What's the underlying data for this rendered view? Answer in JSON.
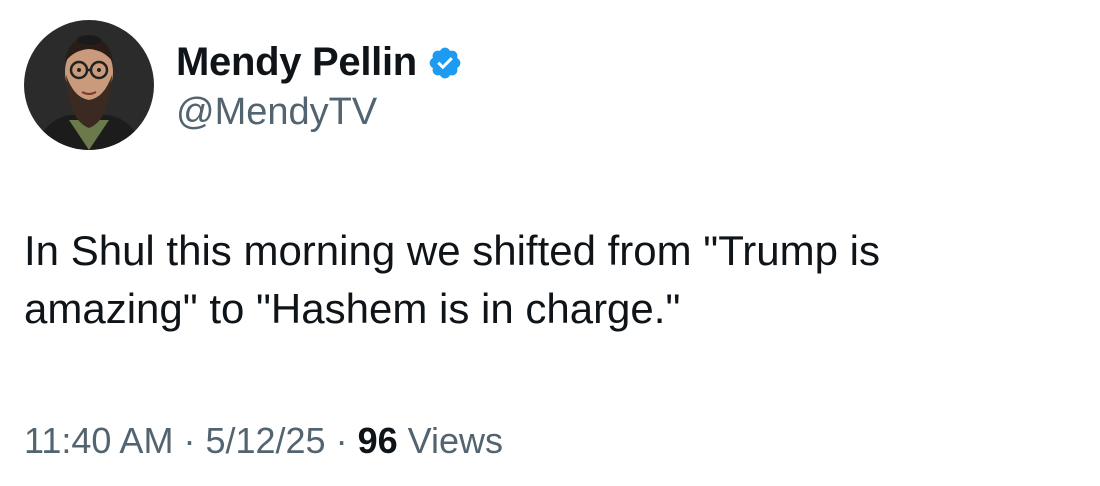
{
  "author": {
    "display_name": "Mendy Pellin",
    "handle": "@MendyTV",
    "verified": true,
    "avatar_icon": "profile-photo-avatar",
    "verified_icon": "verified-badge-icon"
  },
  "tweet": {
    "text": "In Shul this morning we shifted from \"Trump is\namazing\" to \"Hashem is in charge.\""
  },
  "meta": {
    "time": "11:40 AM",
    "separator": "·",
    "date": "5/12/25",
    "views_count": "96",
    "views_label": "Views"
  },
  "colors": {
    "text_primary": "#0f1419",
    "text_secondary": "#536471",
    "verified_blue": "#1d9bf0",
    "background": "#ffffff"
  }
}
